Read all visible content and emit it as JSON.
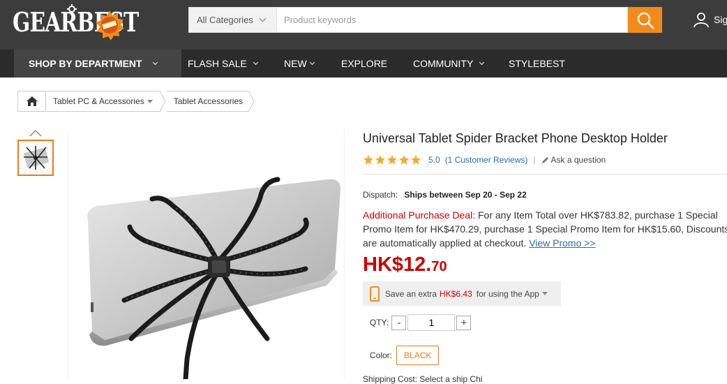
{
  "header": {
    "logo_text": "GEARBEST",
    "search": {
      "category": "All Categories",
      "placeholder": "Product keywords"
    },
    "user_label": "Sig"
  },
  "nav": {
    "items": [
      {
        "label": "SHOP BY DEPARTMENT"
      },
      {
        "label": "FLASH SALE"
      },
      {
        "label": "NEW"
      },
      {
        "label": "EXPLORE"
      },
      {
        "label": "COMMUNITY"
      },
      {
        "label": "STYLEBEST"
      }
    ]
  },
  "breadcrumb": {
    "items": [
      "Tablet PC & Accessories",
      "Tablet Accessories"
    ]
  },
  "product": {
    "title": "Universal Tablet Spider Bracket Phone Desktop Holder",
    "rating": "5.0",
    "reviews": "(1 Customer Reviews)",
    "ask": "Ask a question",
    "dispatch_label": "Dispatch:",
    "dispatch_value": "Ships between Sep 20 - Sep 22",
    "promo_label": "Additional Purchase Deal:",
    "promo_text": " For any Item Total over HK$783.82, purchase 1 Special Promo Item for HK$470.29, purchase 1 Special Promo Item for HK$15.60, Discounts are automatically applied at checkout. ",
    "promo_link": "View Promo >>",
    "price_main": "HK$12.",
    "price_cents": "70",
    "app_save_prefix": "Save an extra",
    "app_save_amount": "HK$6.43",
    "app_save_suffix": "for using the App",
    "qty_label": "QTY:",
    "qty_minus": "-",
    "qty_value": "1",
    "qty_plus": "+",
    "color_label": "Color:",
    "color_value": "BLACK",
    "shipping_peek": "Shipping Cost: Select a ship  Chi"
  },
  "colors": {
    "accent": "#f28b1b",
    "price": "#cc0000",
    "link": "#2a6db2",
    "header_bg": "#3c3c3c",
    "nav_bg": "#2b2b2b"
  }
}
